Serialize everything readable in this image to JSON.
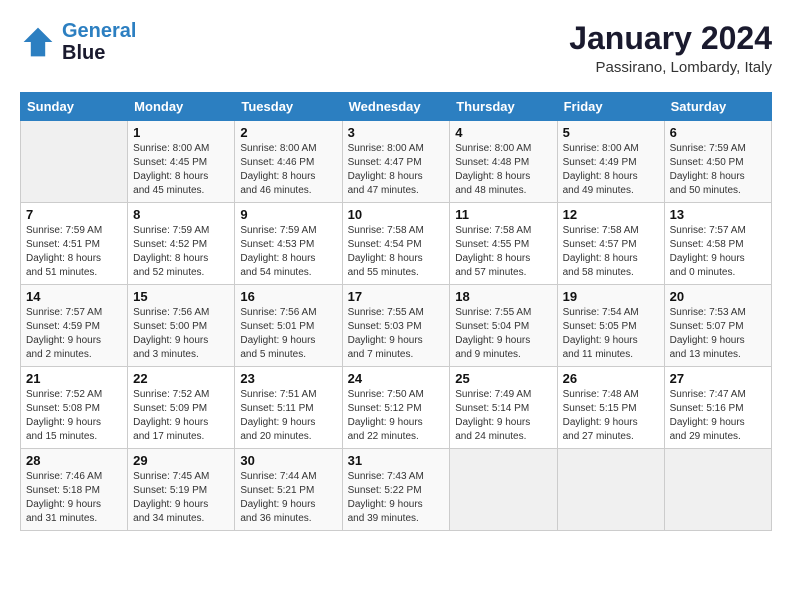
{
  "header": {
    "logo_line1": "General",
    "logo_line2": "Blue",
    "month": "January 2024",
    "location": "Passirano, Lombardy, Italy"
  },
  "days_of_week": [
    "Sunday",
    "Monday",
    "Tuesday",
    "Wednesday",
    "Thursday",
    "Friday",
    "Saturday"
  ],
  "weeks": [
    [
      {
        "day": "",
        "info": ""
      },
      {
        "day": "1",
        "info": "Sunrise: 8:00 AM\nSunset: 4:45 PM\nDaylight: 8 hours\nand 45 minutes."
      },
      {
        "day": "2",
        "info": "Sunrise: 8:00 AM\nSunset: 4:46 PM\nDaylight: 8 hours\nand 46 minutes."
      },
      {
        "day": "3",
        "info": "Sunrise: 8:00 AM\nSunset: 4:47 PM\nDaylight: 8 hours\nand 47 minutes."
      },
      {
        "day": "4",
        "info": "Sunrise: 8:00 AM\nSunset: 4:48 PM\nDaylight: 8 hours\nand 48 minutes."
      },
      {
        "day": "5",
        "info": "Sunrise: 8:00 AM\nSunset: 4:49 PM\nDaylight: 8 hours\nand 49 minutes."
      },
      {
        "day": "6",
        "info": "Sunrise: 7:59 AM\nSunset: 4:50 PM\nDaylight: 8 hours\nand 50 minutes."
      }
    ],
    [
      {
        "day": "7",
        "info": "Sunrise: 7:59 AM\nSunset: 4:51 PM\nDaylight: 8 hours\nand 51 minutes."
      },
      {
        "day": "8",
        "info": "Sunrise: 7:59 AM\nSunset: 4:52 PM\nDaylight: 8 hours\nand 52 minutes."
      },
      {
        "day": "9",
        "info": "Sunrise: 7:59 AM\nSunset: 4:53 PM\nDaylight: 8 hours\nand 54 minutes."
      },
      {
        "day": "10",
        "info": "Sunrise: 7:58 AM\nSunset: 4:54 PM\nDaylight: 8 hours\nand 55 minutes."
      },
      {
        "day": "11",
        "info": "Sunrise: 7:58 AM\nSunset: 4:55 PM\nDaylight: 8 hours\nand 57 minutes."
      },
      {
        "day": "12",
        "info": "Sunrise: 7:58 AM\nSunset: 4:57 PM\nDaylight: 8 hours\nand 58 minutes."
      },
      {
        "day": "13",
        "info": "Sunrise: 7:57 AM\nSunset: 4:58 PM\nDaylight: 9 hours\nand 0 minutes."
      }
    ],
    [
      {
        "day": "14",
        "info": "Sunrise: 7:57 AM\nSunset: 4:59 PM\nDaylight: 9 hours\nand 2 minutes."
      },
      {
        "day": "15",
        "info": "Sunrise: 7:56 AM\nSunset: 5:00 PM\nDaylight: 9 hours\nand 3 minutes."
      },
      {
        "day": "16",
        "info": "Sunrise: 7:56 AM\nSunset: 5:01 PM\nDaylight: 9 hours\nand 5 minutes."
      },
      {
        "day": "17",
        "info": "Sunrise: 7:55 AM\nSunset: 5:03 PM\nDaylight: 9 hours\nand 7 minutes."
      },
      {
        "day": "18",
        "info": "Sunrise: 7:55 AM\nSunset: 5:04 PM\nDaylight: 9 hours\nand 9 minutes."
      },
      {
        "day": "19",
        "info": "Sunrise: 7:54 AM\nSunset: 5:05 PM\nDaylight: 9 hours\nand 11 minutes."
      },
      {
        "day": "20",
        "info": "Sunrise: 7:53 AM\nSunset: 5:07 PM\nDaylight: 9 hours\nand 13 minutes."
      }
    ],
    [
      {
        "day": "21",
        "info": "Sunrise: 7:52 AM\nSunset: 5:08 PM\nDaylight: 9 hours\nand 15 minutes."
      },
      {
        "day": "22",
        "info": "Sunrise: 7:52 AM\nSunset: 5:09 PM\nDaylight: 9 hours\nand 17 minutes."
      },
      {
        "day": "23",
        "info": "Sunrise: 7:51 AM\nSunset: 5:11 PM\nDaylight: 9 hours\nand 20 minutes."
      },
      {
        "day": "24",
        "info": "Sunrise: 7:50 AM\nSunset: 5:12 PM\nDaylight: 9 hours\nand 22 minutes."
      },
      {
        "day": "25",
        "info": "Sunrise: 7:49 AM\nSunset: 5:14 PM\nDaylight: 9 hours\nand 24 minutes."
      },
      {
        "day": "26",
        "info": "Sunrise: 7:48 AM\nSunset: 5:15 PM\nDaylight: 9 hours\nand 27 minutes."
      },
      {
        "day": "27",
        "info": "Sunrise: 7:47 AM\nSunset: 5:16 PM\nDaylight: 9 hours\nand 29 minutes."
      }
    ],
    [
      {
        "day": "28",
        "info": "Sunrise: 7:46 AM\nSunset: 5:18 PM\nDaylight: 9 hours\nand 31 minutes."
      },
      {
        "day": "29",
        "info": "Sunrise: 7:45 AM\nSunset: 5:19 PM\nDaylight: 9 hours\nand 34 minutes."
      },
      {
        "day": "30",
        "info": "Sunrise: 7:44 AM\nSunset: 5:21 PM\nDaylight: 9 hours\nand 36 minutes."
      },
      {
        "day": "31",
        "info": "Sunrise: 7:43 AM\nSunset: 5:22 PM\nDaylight: 9 hours\nand 39 minutes."
      },
      {
        "day": "",
        "info": ""
      },
      {
        "day": "",
        "info": ""
      },
      {
        "day": "",
        "info": ""
      }
    ]
  ]
}
